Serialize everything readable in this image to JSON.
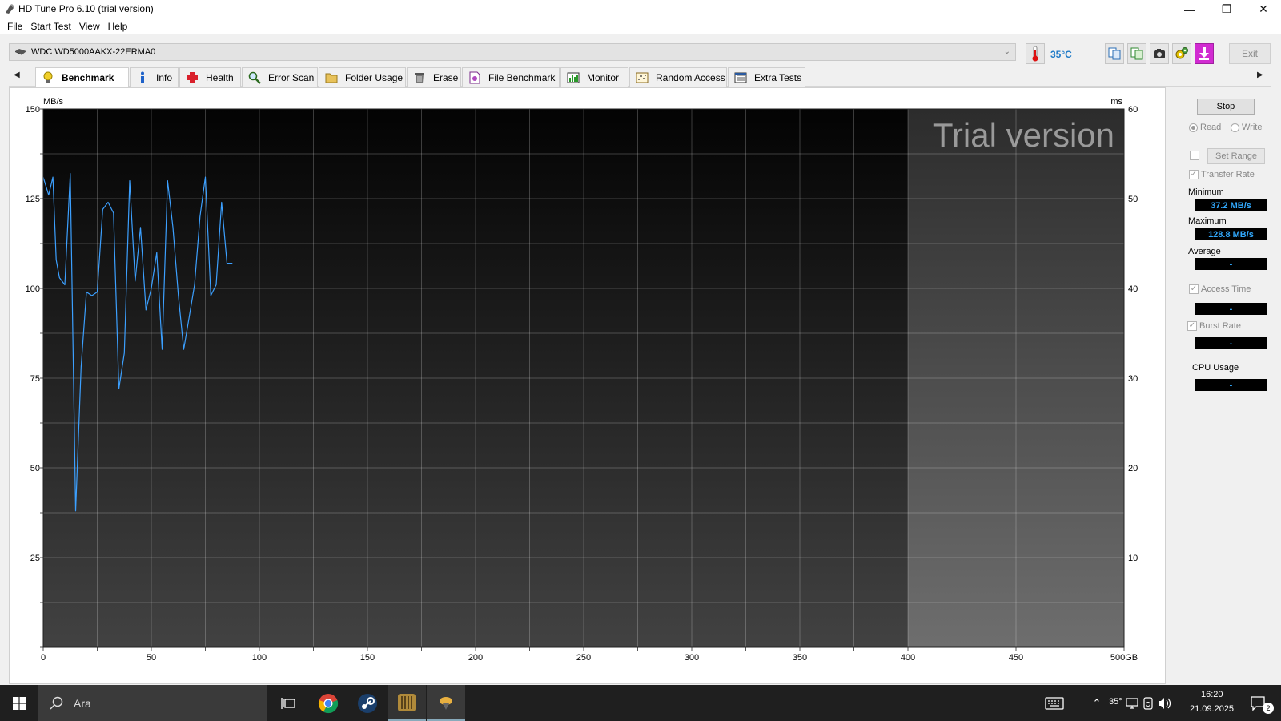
{
  "window": {
    "title": "HD Tune Pro 6.10 (trial version)",
    "controls": {
      "minimize": "—",
      "restore": "❐",
      "close": "✕"
    }
  },
  "menu": [
    "File",
    "Start Test",
    "View",
    "Help"
  ],
  "drive": {
    "name": "WDC WD5000AAKX-22ERMA0",
    "temperature": "35°C"
  },
  "toolbar": {
    "exit_label": "Exit"
  },
  "tabs": [
    {
      "label": "Benchmark",
      "icon": "bulb-icon",
      "active": true
    },
    {
      "label": "Info",
      "icon": "info-icon"
    },
    {
      "label": "Health",
      "icon": "health-cross-icon"
    },
    {
      "label": "Error Scan",
      "icon": "magnifier-icon"
    },
    {
      "label": "Folder Usage",
      "icon": "folder-icon"
    },
    {
      "label": "Erase",
      "icon": "trash-icon"
    },
    {
      "label": "File Benchmark",
      "icon": "file-benchmark-icon"
    },
    {
      "label": "Monitor",
      "icon": "monitor-icon"
    },
    {
      "label": "Random Access",
      "icon": "random-access-icon"
    },
    {
      "label": "Extra Tests",
      "icon": "extra-tests-icon"
    }
  ],
  "controls": {
    "stop_label": "Stop",
    "read_label": "Read",
    "write_label": "Write",
    "set_range_label": "Set Range",
    "transfer_rate_label": "Transfer Rate",
    "minimum_label": "Minimum",
    "minimum_value": "37.2 MB/s",
    "maximum_label": "Maximum",
    "maximum_value": "128.8 MB/s",
    "average_label": "Average",
    "average_value": "-",
    "access_time_label": "Access Time",
    "access_time_value": "-",
    "burst_rate_label": "Burst Rate",
    "burst_rate_value": "-",
    "cpu_usage_label": "CPU Usage",
    "cpu_usage_value": "-"
  },
  "chart_data": {
    "type": "line",
    "watermark": "Trial version",
    "y_left_unit": "MB/s",
    "y_right_unit": "ms",
    "x_ticks": [
      "0",
      "50",
      "100",
      "150",
      "200",
      "250",
      "300",
      "350",
      "400",
      "450",
      "500GB"
    ],
    "x_tick_values": [
      0,
      50,
      100,
      150,
      200,
      250,
      300,
      350,
      400,
      450,
      500
    ],
    "y_left_ticks": [
      150,
      125,
      100,
      75,
      50,
      25
    ],
    "y_right_ticks": [
      60,
      50,
      40,
      30,
      20,
      10
    ],
    "xlim": [
      0,
      500
    ],
    "ylim": [
      0,
      150
    ],
    "tested_range_end": 400,
    "series": [
      {
        "color": "#3ca0ff",
        "x": [
          0,
          2.5,
          4.5,
          6,
          7.5,
          10,
          12.5,
          15,
          17.5,
          20,
          22.5,
          25,
          27.5,
          30,
          32.5,
          35,
          37.5,
          40,
          42.5,
          45,
          47.5,
          50,
          52.5,
          55,
          57.5,
          60,
          62.5,
          65,
          67.5,
          70,
          72.5,
          75,
          77.5,
          80,
          82.5,
          85,
          87.5
        ],
        "y": [
          131,
          126,
          131,
          108,
          103,
          101,
          132,
          38,
          78,
          99,
          98,
          99,
          122,
          124,
          121,
          72,
          82,
          130,
          102,
          117,
          94,
          100,
          110,
          83,
          130,
          117,
          98,
          83,
          92,
          101,
          120,
          131,
          98,
          101,
          124,
          107,
          107
        ]
      }
    ]
  },
  "taskbar": {
    "search_placeholder": "Ara",
    "weather": "35°",
    "time": "16:20",
    "date": "21.09.2025",
    "notifications": "2"
  }
}
